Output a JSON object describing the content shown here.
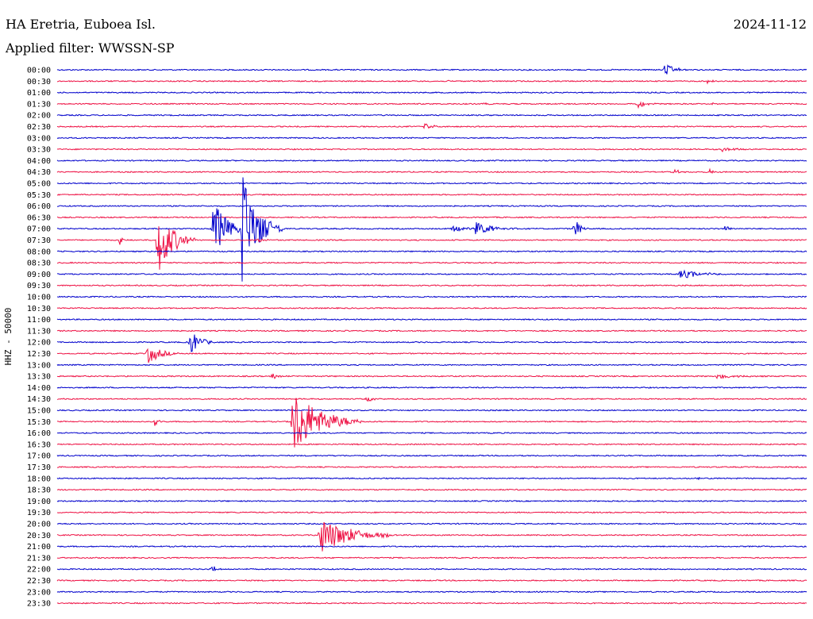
{
  "header": {
    "station": "HA Eretria, Euboea Isl.",
    "date": "2024-11-12",
    "filter": "Applied filter: WWSSN-SP"
  },
  "chart_data": {
    "type": "line",
    "title": "HA Eretria, Euboea Isl.",
    "ylabel": "HHZ - 50000",
    "colors": {
      "even": "#0000cc",
      "odd": "#ee1144"
    },
    "rows": [
      "00:00",
      "00:30",
      "01:00",
      "01:30",
      "02:00",
      "02:30",
      "03:00",
      "03:30",
      "04:00",
      "04:30",
      "05:00",
      "05:30",
      "06:00",
      "06:30",
      "07:00",
      "07:30",
      "08:00",
      "08:30",
      "09:00",
      "09:30",
      "10:00",
      "10:30",
      "11:00",
      "11:30",
      "12:00",
      "12:30",
      "13:00",
      "13:30",
      "14:00",
      "14:30",
      "15:00",
      "15:30",
      "16:00",
      "16:30",
      "17:00",
      "17:30",
      "18:00",
      "18:30",
      "19:00",
      "19:30",
      "20:00",
      "20:30",
      "21:00",
      "21:30",
      "22:00",
      "22:30",
      "23:00",
      "23:30"
    ],
    "x_unit": "minutes into row (0-30)",
    "events": [
      {
        "row": "00:00",
        "minute": 24.3,
        "amp": 9,
        "dur": 1.0
      },
      {
        "row": "00:30",
        "minute": 15.7,
        "amp": 2,
        "dur": 0.4
      },
      {
        "row": "00:30",
        "minute": 26.0,
        "amp": 3,
        "dur": 0.5
      },
      {
        "row": "01:30",
        "minute": 17.1,
        "amp": 2,
        "dur": 0.4
      },
      {
        "row": "01:30",
        "minute": 23.2,
        "amp": 6,
        "dur": 0.8
      },
      {
        "row": "01:30",
        "minute": 26.2,
        "amp": 2,
        "dur": 0.4
      },
      {
        "row": "02:30",
        "minute": 14.7,
        "amp": 6,
        "dur": 0.6
      },
      {
        "row": "03:30",
        "minute": 26.6,
        "amp": 4,
        "dur": 1.0
      },
      {
        "row": "04:30",
        "minute": 24.7,
        "amp": 4,
        "dur": 0.5
      },
      {
        "row": "04:30",
        "minute": 26.1,
        "amp": 4,
        "dur": 0.4
      },
      {
        "row": "07:00",
        "minute": 6.2,
        "amp": 42,
        "dur": 1.4
      },
      {
        "row": "07:00",
        "minute": 7.4,
        "amp": 70,
        "dur": 1.6
      },
      {
        "row": "07:00",
        "minute": 8.6,
        "amp": 5,
        "dur": 0.6
      },
      {
        "row": "07:00",
        "minute": 15.8,
        "amp": 5,
        "dur": 1.4
      },
      {
        "row": "07:00",
        "minute": 16.7,
        "amp": 10,
        "dur": 1.8
      },
      {
        "row": "07:00",
        "minute": 20.7,
        "amp": 14,
        "dur": 0.6
      },
      {
        "row": "07:00",
        "minute": 26.7,
        "amp": 5,
        "dur": 0.5
      },
      {
        "row": "07:30",
        "minute": 2.5,
        "amp": 7,
        "dur": 0.4
      },
      {
        "row": "07:30",
        "minute": 4.0,
        "amp": 48,
        "dur": 1.5
      },
      {
        "row": "07:30",
        "minute": 8.0,
        "amp": 5,
        "dur": 0.6
      },
      {
        "row": "09:00",
        "minute": 24.9,
        "amp": 6,
        "dur": 2.2
      },
      {
        "row": "12:00",
        "minute": 5.3,
        "amp": 18,
        "dur": 1.0
      },
      {
        "row": "12:30",
        "minute": 3.6,
        "amp": 14,
        "dur": 1.3
      },
      {
        "row": "13:30",
        "minute": 8.6,
        "amp": 5,
        "dur": 0.6
      },
      {
        "row": "13:30",
        "minute": 26.4,
        "amp": 3,
        "dur": 2.0
      },
      {
        "row": "14:30",
        "minute": 12.4,
        "amp": 4,
        "dur": 0.6
      },
      {
        "row": "15:30",
        "minute": 3.9,
        "amp": 6,
        "dur": 0.5
      },
      {
        "row": "15:30",
        "minute": 9.4,
        "amp": 45,
        "dur": 2.8
      },
      {
        "row": "18:00",
        "minute": 25.6,
        "amp": 3,
        "dur": 0.4
      },
      {
        "row": "20:30",
        "minute": 10.5,
        "amp": 25,
        "dur": 3.0
      },
      {
        "row": "22:00",
        "minute": 6.2,
        "amp": 8,
        "dur": 0.4
      }
    ],
    "grid": false
  }
}
